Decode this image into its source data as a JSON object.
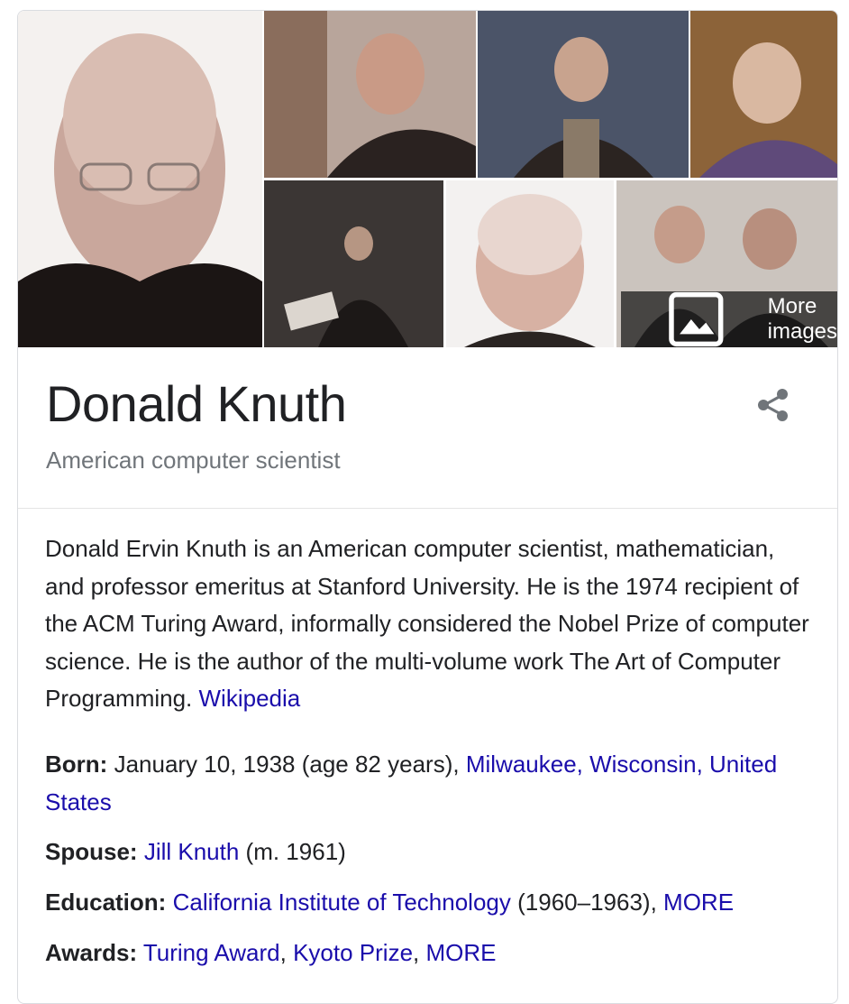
{
  "panel": {
    "title": "Donald Knuth",
    "subtitle": "American computer scientist",
    "more_images_label": "More images"
  },
  "description": {
    "text": "Donald Ervin Knuth is an American computer scientist, mathematician, and professor emeritus at Stanford University. He is the 1974 recipient of the ACM Turing Award, informally considered the Nobel Prize of computer science. He is the author of the multi-volume work The Art of Computer Programming.",
    "source_link": "Wikipedia"
  },
  "facts": {
    "born": {
      "label": "Born:",
      "text": "January 10, 1938 (age 82 years),",
      "place_link": "Milwaukee, Wisconsin, United States"
    },
    "spouse": {
      "label": "Spouse:",
      "link": "Jill Knuth",
      "text": "(m. 1961)"
    },
    "education": {
      "label": "Education:",
      "link": "California Institute of Technology",
      "text": "(1960–1963),",
      "more": "MORE"
    },
    "awards": {
      "label": "Awards:",
      "link1": "Turing Award",
      "sep": ",",
      "link2": "Kyoto Prize",
      "sep2": ",",
      "more": "MORE"
    }
  },
  "colors": {
    "link": "#1a0dab",
    "text": "#202124",
    "subtitle": "#70757a",
    "border": "#dadce0"
  },
  "icons": [
    "image-icon",
    "share-icon"
  ]
}
